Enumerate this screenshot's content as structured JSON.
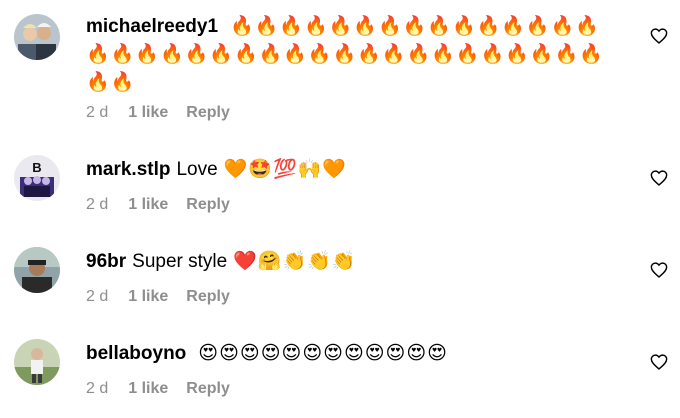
{
  "comments": [
    {
      "username": "michaelreedy1",
      "text": "",
      "emojis": "🔥🔥🔥🔥🔥🔥🔥🔥🔥🔥🔥🔥🔥🔥🔥🔥🔥🔥🔥🔥🔥🔥🔥🔥🔥🔥🔥🔥🔥🔥🔥🔥🔥🔥🔥🔥🔥🔥",
      "time": "2 d",
      "likes": "1 like",
      "reply": "Reply"
    },
    {
      "username": "mark.stlp",
      "text": "Love",
      "emojis": "🧡🤩💯🙌🧡",
      "time": "2 d",
      "likes": "1 like",
      "reply": "Reply"
    },
    {
      "username": "96br",
      "text": "Super style",
      "emojis": "❤️🤗👏👏👏",
      "time": "2 d",
      "likes": "1 like",
      "reply": "Reply"
    },
    {
      "username": "bellaboyno",
      "text": "",
      "emojis": "😍😍😍😍😍😍😍😍😍😍😍😍",
      "time": "2 d",
      "likes": "1 like",
      "reply": "Reply"
    }
  ],
  "colors": {
    "text": "#000000",
    "meta": "#8e8e8e"
  },
  "icons": {
    "like": "heart-outline-icon"
  }
}
